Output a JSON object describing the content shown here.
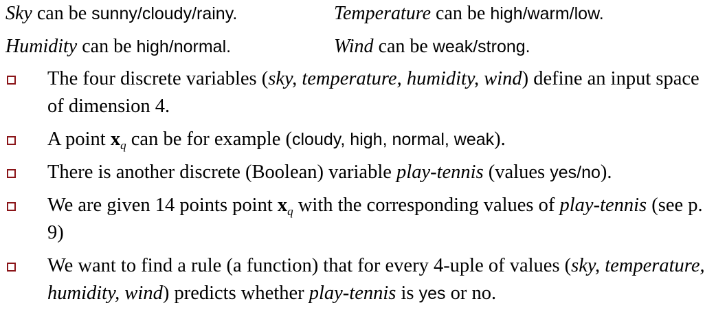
{
  "definitions": {
    "sky": {
      "name": "Sky",
      "text": " can be ",
      "values": "sunny/cloudy/rainy",
      "end": "."
    },
    "temperature": {
      "name": "Temperature",
      "text": " can be ",
      "values": "high/warm/low",
      "end": "."
    },
    "humidity": {
      "name": "Humidity",
      "text": " can be ",
      "values": "high/normal",
      "end": "."
    },
    "wind": {
      "name": "Wind",
      "text": " can be ",
      "values": "weak/strong",
      "end": "."
    }
  },
  "bullets": {
    "b1": {
      "pre": "The four discrete variables (",
      "vars": "sky, temperature, humidity, wind",
      "post": ") define an input space of dimension 4."
    },
    "b2": {
      "pre": "A point ",
      "x": "x",
      "sub": "q",
      "mid": " can be for example (",
      "example": "cloudy, high, normal, weak",
      "post": ")."
    },
    "b3": {
      "pre": "There is another discrete (Boolean) variable ",
      "var": "play-tennis",
      "mid": " (values ",
      "values": "yes/no",
      "post": ")."
    },
    "b4": {
      "pre": "We are given 14 points point ",
      "x": "x",
      "sub": "q",
      "mid": " with the corresponding values of ",
      "var": "play-tennis",
      "post": " (see p. 9)"
    },
    "b5": {
      "pre": "We want to find a rule (a function) that for every 4-uple of values (",
      "vars": "sky, temperature, humidity, wind",
      "mid": ") predicts whether ",
      "var": "play-tennis",
      "is": " is ",
      "yes": "yes",
      "or": " or no."
    }
  },
  "colors": {
    "bullet": "#8a1418",
    "text": "#000000",
    "background": "#ffffff"
  },
  "icons": {
    "bullet": "hollow-square-bullet-icon"
  }
}
